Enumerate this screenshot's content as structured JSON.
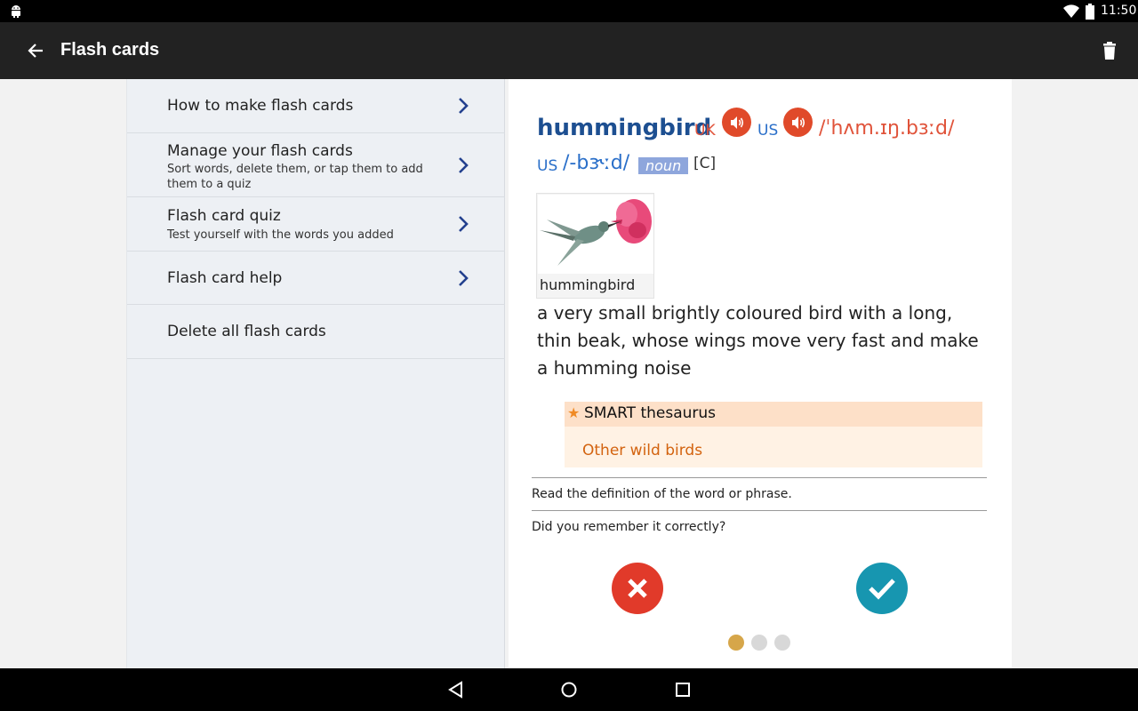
{
  "status_bar": {
    "time": "11:50"
  },
  "app_bar": {
    "title": "Flash cards"
  },
  "menu": {
    "items": [
      {
        "label": "How to make flash cards",
        "sub": ""
      },
      {
        "label": "Manage your flash cards",
        "sub": "Sort words, delete them, or tap them to add them to a quiz"
      },
      {
        "label": "Flash card quiz",
        "sub": "Test yourself with the words you added"
      },
      {
        "label": "Flash card help",
        "sub": ""
      },
      {
        "label": "Delete all flash cards",
        "sub": ""
      }
    ]
  },
  "entry": {
    "headword": "hummingbird",
    "uk_label": "UK",
    "us_label": "US",
    "uk_ipa": "/ˈhʌm.ɪŋ.bɜːd/",
    "us_ipa": "/-bɝːd/",
    "pos": "noun",
    "grammar": "[C]",
    "image_caption": "hummingbird",
    "definition": "a very small brightly coloured bird with a long, thin beak, whose wings move very fast and make a humming noise",
    "thesaurus_title": "SMART thesaurus",
    "thesaurus_link": "Other wild birds"
  },
  "quiz": {
    "instruction": "Read the definition of the word or phrase.",
    "question": "Did you remember it correctly?",
    "progress": {
      "current": 1,
      "total": 3
    }
  },
  "colors": {
    "accent_headword": "#1d4f91",
    "uk": "#e0533a",
    "us": "#2a6fc9",
    "wrong": "#e13a2a",
    "right": "#1796b0",
    "active_dot": "#d6a64a"
  }
}
